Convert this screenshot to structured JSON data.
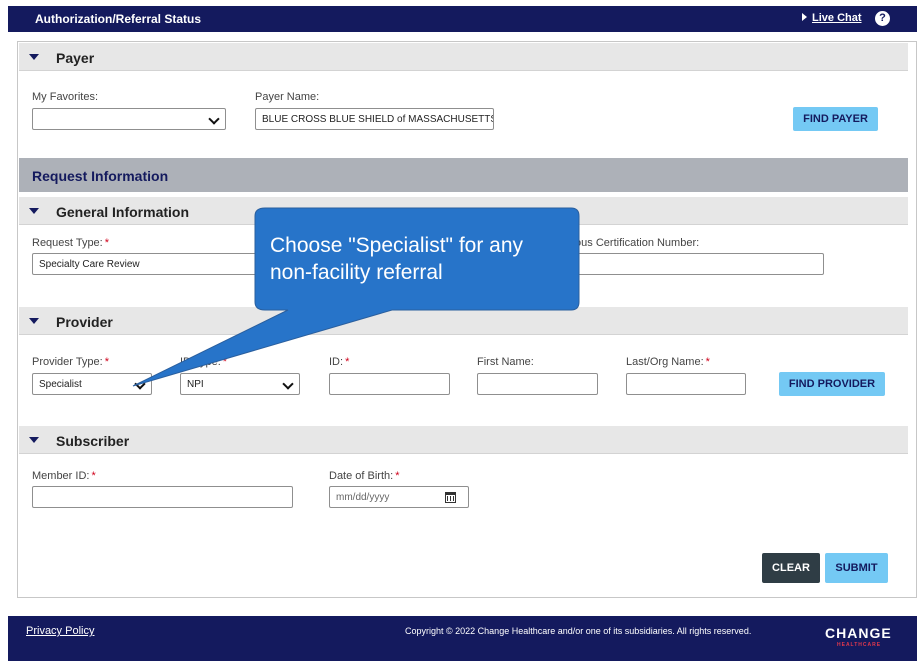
{
  "header": {
    "title": "Authorization/Referral Status",
    "live_chat": "Live Chat",
    "help": "?"
  },
  "payer": {
    "section_title": "Payer",
    "favorites_label": "My Favorites:",
    "favorites_value": "",
    "payer_name_label": "Payer Name:",
    "payer_name_value": "BLUE CROSS BLUE SHIELD of MASSACHUSETTS",
    "find_payer": "FIND PAYER"
  },
  "request_info": {
    "section_title": "Request Information"
  },
  "general": {
    "section_title": "General Information",
    "request_type_label": "Request Type:",
    "request_type_value": "Specialty Care Review",
    "prev_cert_label": "Previous Certification Number:",
    "prev_cert_value": ""
  },
  "provider": {
    "section_title": "Provider",
    "type_label": "Provider Type:",
    "type_value": "Specialist",
    "id_type_label": "ID Type:",
    "id_type_value": "NPI",
    "id_label": "ID:",
    "first_name_label": "First Name:",
    "last_name_label": "Last/Org Name:",
    "find_provider": "FIND PROVIDER"
  },
  "subscriber": {
    "section_title": "Subscriber",
    "member_id_label": "Member ID:",
    "dob_label": "Date of Birth:",
    "dob_placeholder": "mm/dd/yyyy"
  },
  "actions": {
    "clear": "CLEAR",
    "submit": "SUBMIT"
  },
  "callout": {
    "text": "Choose \"Specialist\" for any non-facility referral"
  },
  "footer": {
    "privacy": "Privacy Policy",
    "copyright": "Copyright © 2022 Change Healthcare and/or one of its subsidiaries. All rights reserved.",
    "logo": "CHANGE",
    "logo_sub": "HEALTHCARE"
  },
  "colors": {
    "navy": "#141a5e",
    "accent_blue": "#74c9f4",
    "callout_blue": "#2774c9",
    "required_red": "#d0021b"
  }
}
